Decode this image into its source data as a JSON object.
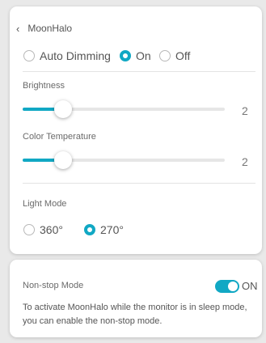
{
  "header": {
    "back_icon": "chevron-left-icon",
    "title": "MoonHalo"
  },
  "auto_dimming": {
    "label": "Auto Dimming",
    "options": [
      {
        "label": "On",
        "selected": true
      },
      {
        "label": "Off",
        "selected": false
      }
    ]
  },
  "brightness": {
    "label": "Brightness",
    "value": "2",
    "level": 0.2
  },
  "color_temperature": {
    "label": "Color Temperature",
    "value": "2",
    "level": 0.2
  },
  "light_mode": {
    "label": "Light Mode",
    "options": [
      {
        "label": "360°",
        "selected": false
      },
      {
        "label": "270°",
        "selected": true
      }
    ]
  },
  "nonstop": {
    "label": "Non-stop Mode",
    "toggle_label": "ON",
    "enabled": true,
    "description": "To activate MoonHalo while the monitor is in sleep mode, you can enable the non-stop mode."
  },
  "colors": {
    "accent": "#11a8c4",
    "track": "#e6e6e6"
  }
}
